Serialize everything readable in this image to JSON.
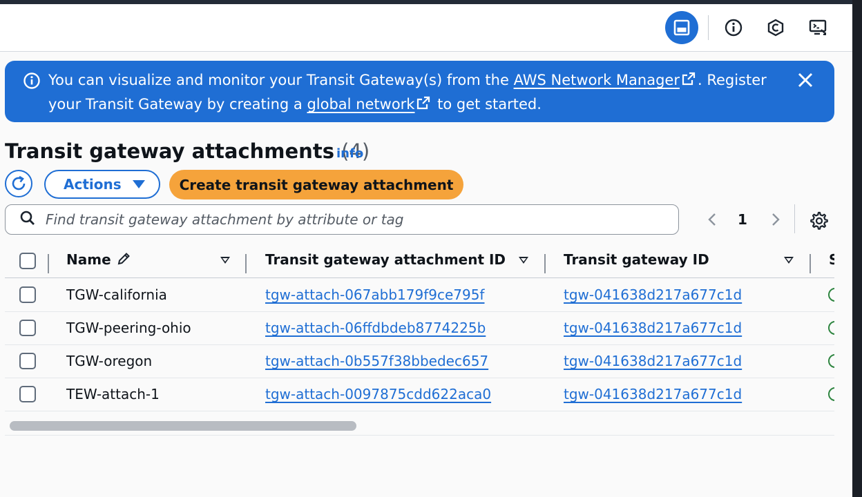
{
  "banner": {
    "text_1": "You can visualize and monitor your Transit Gateway(s) from the",
    "link_1": "AWS Network Manager",
    "text_2": ". Register your Transit Gateway by creating a",
    "link_2": "global network",
    "text_3": "to get started."
  },
  "header_icons": [
    "panel-layout-icon",
    "info-icon",
    "hexagon-c-icon",
    "remote-console-icon"
  ],
  "section": {
    "title": "Transit gateway attachments",
    "count": "(4)",
    "info_link": "info"
  },
  "toolbar": {
    "actions_label": "Actions",
    "create_label": "Create transit gateway attachment"
  },
  "search": {
    "placeholder": "Find transit gateway attachment by attribute or tag",
    "value": ""
  },
  "pagination": {
    "current_page": "1"
  },
  "table": {
    "columns": {
      "name": "Name",
      "attachment_id": "Transit gateway attachment ID",
      "tgw_id": "Transit gateway ID",
      "state": "S"
    },
    "rows": [
      {
        "name": "TGW-california",
        "attachment_id": "tgw-attach-067abb179f9ce795f",
        "tgw_id": "tgw-041638d217a677c1d"
      },
      {
        "name": "TGW-peering-ohio",
        "attachment_id": "tgw-attach-06ffdbdeb8774225b",
        "tgw_id": "tgw-041638d217a677c1d"
      },
      {
        "name": "TGW-oregon",
        "attachment_id": "tgw-attach-0b557f38bbedec657",
        "tgw_id": "tgw-041638d217a677c1d"
      },
      {
        "name": "TEW-attach-1",
        "attachment_id": "tgw-attach-0097875cdd622aca0",
        "tgw_id": "tgw-041638d217a677c1d"
      }
    ]
  },
  "colors": {
    "accent": "#1f6ed4",
    "primary_button": "#f5a33b",
    "status_ok": "#2e8540"
  }
}
